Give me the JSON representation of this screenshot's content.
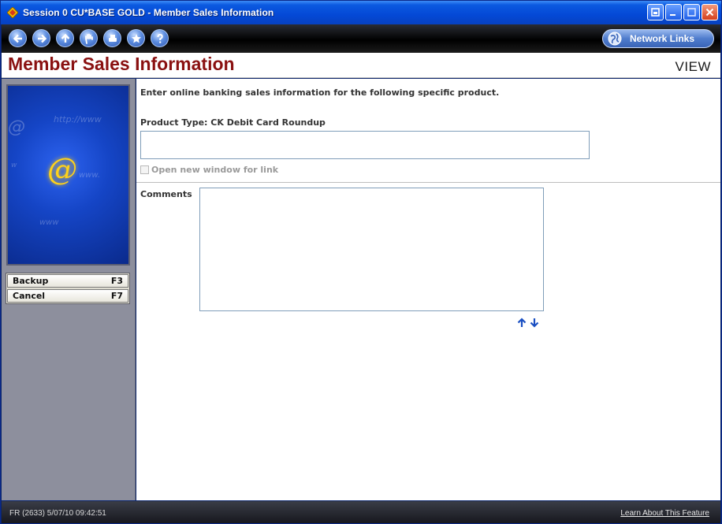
{
  "window": {
    "title": "Session 0 CU*BASE GOLD - Member Sales Information"
  },
  "toolbar": {
    "nav_buttons": [
      "back",
      "forward",
      "up",
      "stop",
      "print",
      "favorites",
      "help"
    ],
    "network_links_label": "Network Links"
  },
  "header": {
    "page_title": "Member Sales Information",
    "mode": "VIEW"
  },
  "sidebar": {
    "function_keys": [
      {
        "label": "Backup",
        "key": "F3"
      },
      {
        "label": "Cancel",
        "key": "F7"
      }
    ]
  },
  "form": {
    "instruction": "Enter online banking sales information for the following specific product.",
    "product_type": "Product Type: CK Debit Card Roundup",
    "link_value": "",
    "open_new_window_label": "Open new window for link",
    "open_new_window_checked": false,
    "comments_label": "Comments",
    "comments_value": ""
  },
  "statusbar": {
    "status_text": "FR (2633) 5/07/10 09:42:51",
    "learn_link": "Learn About This Feature"
  },
  "colors": {
    "title_accent": "#8a1111",
    "titlebar_blue": "#0449d6",
    "sidebar_gray": "#8d8f9d"
  }
}
